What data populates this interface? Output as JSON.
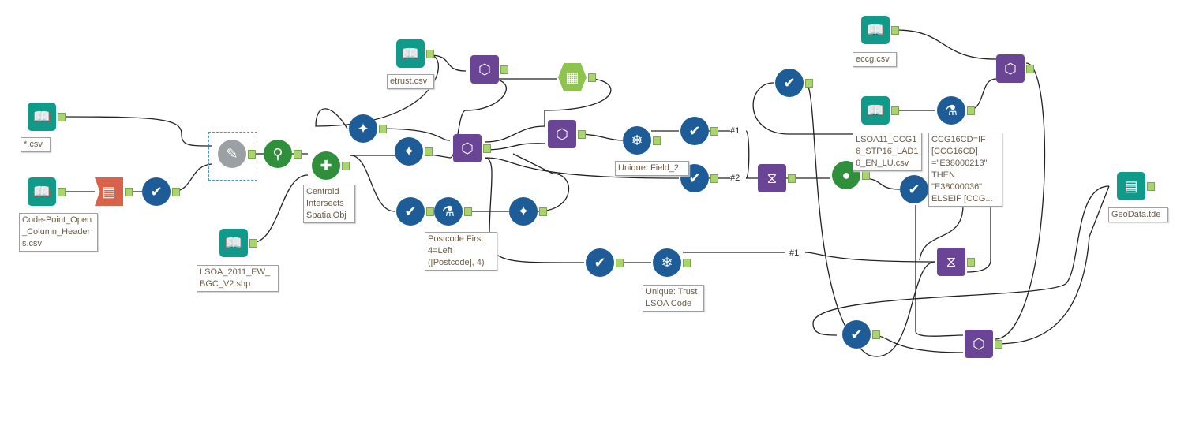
{
  "workflow": {
    "annotations": {
      "star_csv": "*.csv",
      "code_point": "Code-Point_Open_Column_Headers.csv",
      "lsoa_shp": "LSOA_2011_EW_BGC_V2.shp",
      "centroid": "Centroid Intersects SpatialObj",
      "etrust": "etrust.csv",
      "postcode": "Postcode First 4=Left ([Postcode], 4)",
      "unique_field2": "Unique: Field_2",
      "unique_trust": "Unique: Trust LSOA Code",
      "eccg": "eccg.csv",
      "lsoa11": "LSOA11_CCG16_STP16_LAD16_EN_LU.csv",
      "ccg_formula": "CCG16CD=IF [CCG16CD] =\"E38000213\" THEN \"E38000036\" ELSEIF [CCG...",
      "geodata": "GeoData.tde"
    },
    "wire_labels": {
      "a": "#1",
      "b": "#2",
      "c": "#1"
    },
    "anchors": {
      "L": "L",
      "R": "R",
      "J": "J",
      "T": "T",
      "U": "U",
      "M": "M",
      "D": "D"
    },
    "colors": {
      "input": "#0f9a8a",
      "select": "#1d5c96",
      "join": "#6a4596",
      "spatial": "#2f8f3a",
      "text_to_columns": "#d9634a",
      "summarize": "#8ec34e"
    }
  }
}
